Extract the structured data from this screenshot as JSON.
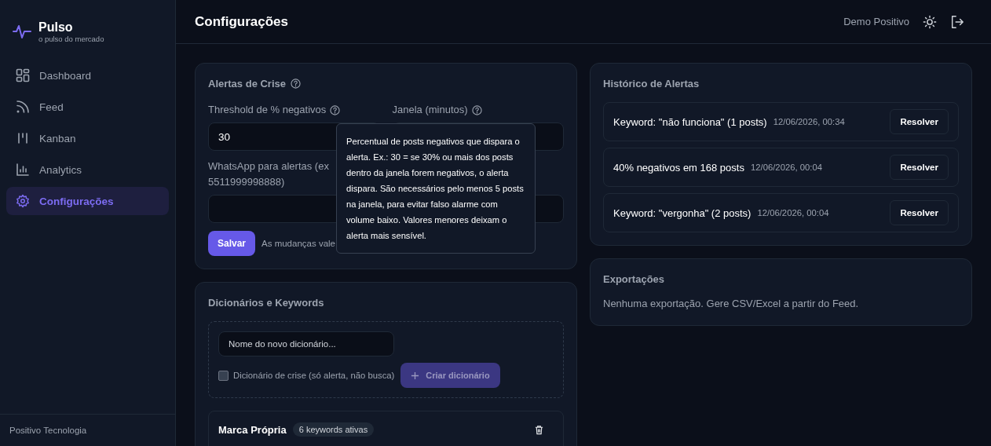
{
  "brand": {
    "name": "Pulso",
    "tagline": "o pulso do mercado"
  },
  "sidebar": {
    "items": [
      {
        "label": "Dashboard",
        "selected": false
      },
      {
        "label": "Feed",
        "selected": false
      },
      {
        "label": "Kanban",
        "selected": false
      },
      {
        "label": "Analytics",
        "selected": false
      },
      {
        "label": "Configurações",
        "selected": true
      }
    ],
    "footer": "Positivo Tecnologia"
  },
  "header": {
    "title": "Configurações",
    "user": "Demo Positivo"
  },
  "crisis_alerts": {
    "title": "Alertas de Crise",
    "threshold": {
      "label": "Threshold de % negativos",
      "value": "30"
    },
    "window": {
      "label": "Janela (minutos)"
    },
    "whatsapp": {
      "label_lines": [
        "WhatsApp para alertas (ex",
        "5511999998888)"
      ]
    },
    "save_button": "Salvar",
    "hint": "As mudanças vale",
    "tooltip": "Percentual de posts negativos que dispara o alerta. Ex.: 30 = se 30% ou mais dos posts dentro da janela forem negativos, o alerta dispara. São necessários pelo menos 5 posts na janela, para evitar falso alarme com volume baixo. Valores menores deixam o alerta mais sensível."
  },
  "dictionaries": {
    "title": "Dicionários e Keywords",
    "new_name": {
      "placeholder": "Nome do novo dicionário..."
    },
    "crisis_checkbox": {
      "label": "Dicionário de crise (só alerta, não busca)",
      "checked": false
    },
    "create_button": {
      "label": "Criar dicionário",
      "disabled": true
    },
    "items": [
      {
        "name": "Marca Própria",
        "badge": "6 keywords ativas"
      }
    ]
  },
  "alert_history": {
    "title": "Histórico de Alertas",
    "alerts": [
      {
        "text": "Keyword: \"não funciona\" (1 posts)",
        "time": "12/06/2026, 00:34",
        "action": "Resolver"
      },
      {
        "text": "40% negativos em 168 posts",
        "time": "12/06/2026, 00:04",
        "action": "Resolver"
      },
      {
        "text": "Keyword: \"vergonha\" (2 posts)",
        "time": "12/06/2026, 00:04",
        "action": "Resolver"
      }
    ]
  },
  "exports": {
    "title": "Exportações",
    "empty": "Nenhuma exportação. Gere CSV/Excel a partir do Feed."
  }
}
